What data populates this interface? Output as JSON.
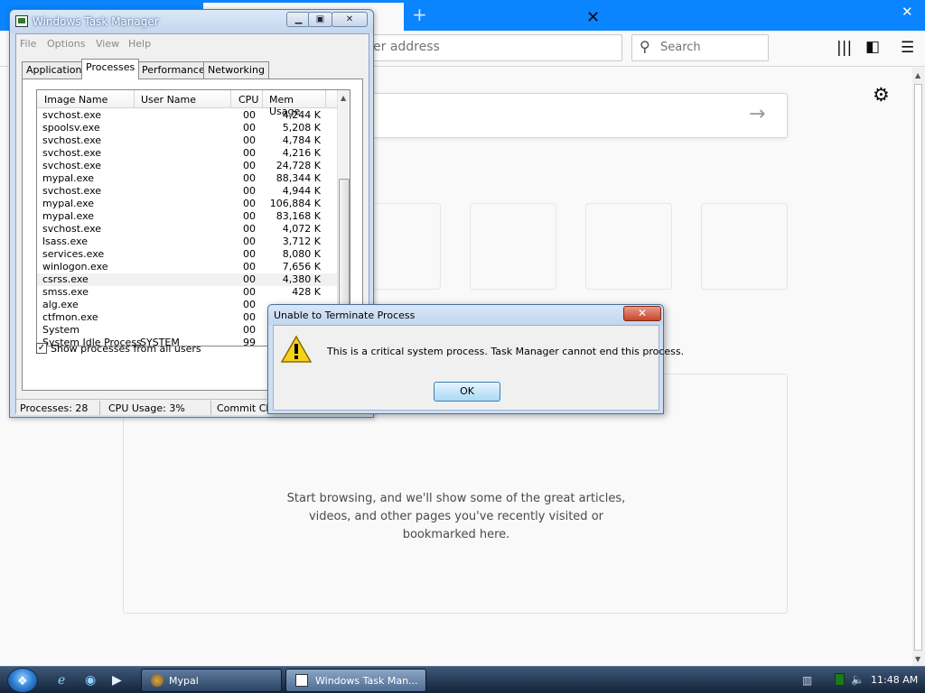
{
  "browser": {
    "url_placeholder": "er address",
    "search_placeholder": "Search",
    "tab_close": "✕",
    "new_tab": "+",
    "window_close": "✕",
    "highlights_message": "Start browsing, and we'll show some of the great articles, videos, and other pages you've recently visited or bookmarked here."
  },
  "task_manager": {
    "title": "Windows Task Manager",
    "menu": [
      "File",
      "Options",
      "View",
      "Help"
    ],
    "tabs": [
      "Applications",
      "Processes",
      "Performance",
      "Networking"
    ],
    "active_tab": "Processes",
    "columns": [
      "Image Name",
      "User Name",
      "CPU",
      "Mem Usage"
    ],
    "processes": [
      {
        "name": "svchost.exe",
        "user": "",
        "cpu": "00",
        "mem": "4,244 K"
      },
      {
        "name": "spoolsv.exe",
        "user": "",
        "cpu": "00",
        "mem": "5,208 K"
      },
      {
        "name": "svchost.exe",
        "user": "",
        "cpu": "00",
        "mem": "4,784 K"
      },
      {
        "name": "svchost.exe",
        "user": "",
        "cpu": "00",
        "mem": "4,216 K"
      },
      {
        "name": "svchost.exe",
        "user": "",
        "cpu": "00",
        "mem": "24,728 K"
      },
      {
        "name": "mypal.exe",
        "user": "",
        "cpu": "00",
        "mem": "88,344 K"
      },
      {
        "name": "svchost.exe",
        "user": "",
        "cpu": "00",
        "mem": "4,944 K"
      },
      {
        "name": "mypal.exe",
        "user": "",
        "cpu": "00",
        "mem": "106,884 K"
      },
      {
        "name": "mypal.exe",
        "user": "",
        "cpu": "00",
        "mem": "83,168 K"
      },
      {
        "name": "svchost.exe",
        "user": "",
        "cpu": "00",
        "mem": "4,072 K"
      },
      {
        "name": "lsass.exe",
        "user": "",
        "cpu": "00",
        "mem": "3,712 K"
      },
      {
        "name": "services.exe",
        "user": "",
        "cpu": "00",
        "mem": "8,080 K"
      },
      {
        "name": "winlogon.exe",
        "user": "",
        "cpu": "00",
        "mem": "7,656 K"
      },
      {
        "name": "csrss.exe",
        "user": "",
        "cpu": "00",
        "mem": "4,380 K"
      },
      {
        "name": "smss.exe",
        "user": "",
        "cpu": "00",
        "mem": "428 K"
      },
      {
        "name": "alg.exe",
        "user": "",
        "cpu": "00",
        "mem": ""
      },
      {
        "name": "ctfmon.exe",
        "user": "",
        "cpu": "00",
        "mem": ""
      },
      {
        "name": "System",
        "user": "",
        "cpu": "00",
        "mem": ""
      },
      {
        "name": "System Idle Process",
        "user": "SYSTEM",
        "cpu": "99",
        "mem": ""
      }
    ],
    "selected_row": 13,
    "show_all_label": "Show processes from all users",
    "show_all_checked": true,
    "checkmark": "✓",
    "status": {
      "processes": "Processes: 28",
      "cpu": "CPU Usage: 3%",
      "commit": "Commit Cha"
    }
  },
  "dialog": {
    "title": "Unable to Terminate Process",
    "message": "This is a critical system process.  Task Manager cannot end this process.",
    "ok": "OK",
    "close": "✕"
  },
  "taskbar": {
    "buttons": [
      "Mypal",
      "Windows Task Man..."
    ],
    "active": 1,
    "clock": "11:48 AM"
  }
}
